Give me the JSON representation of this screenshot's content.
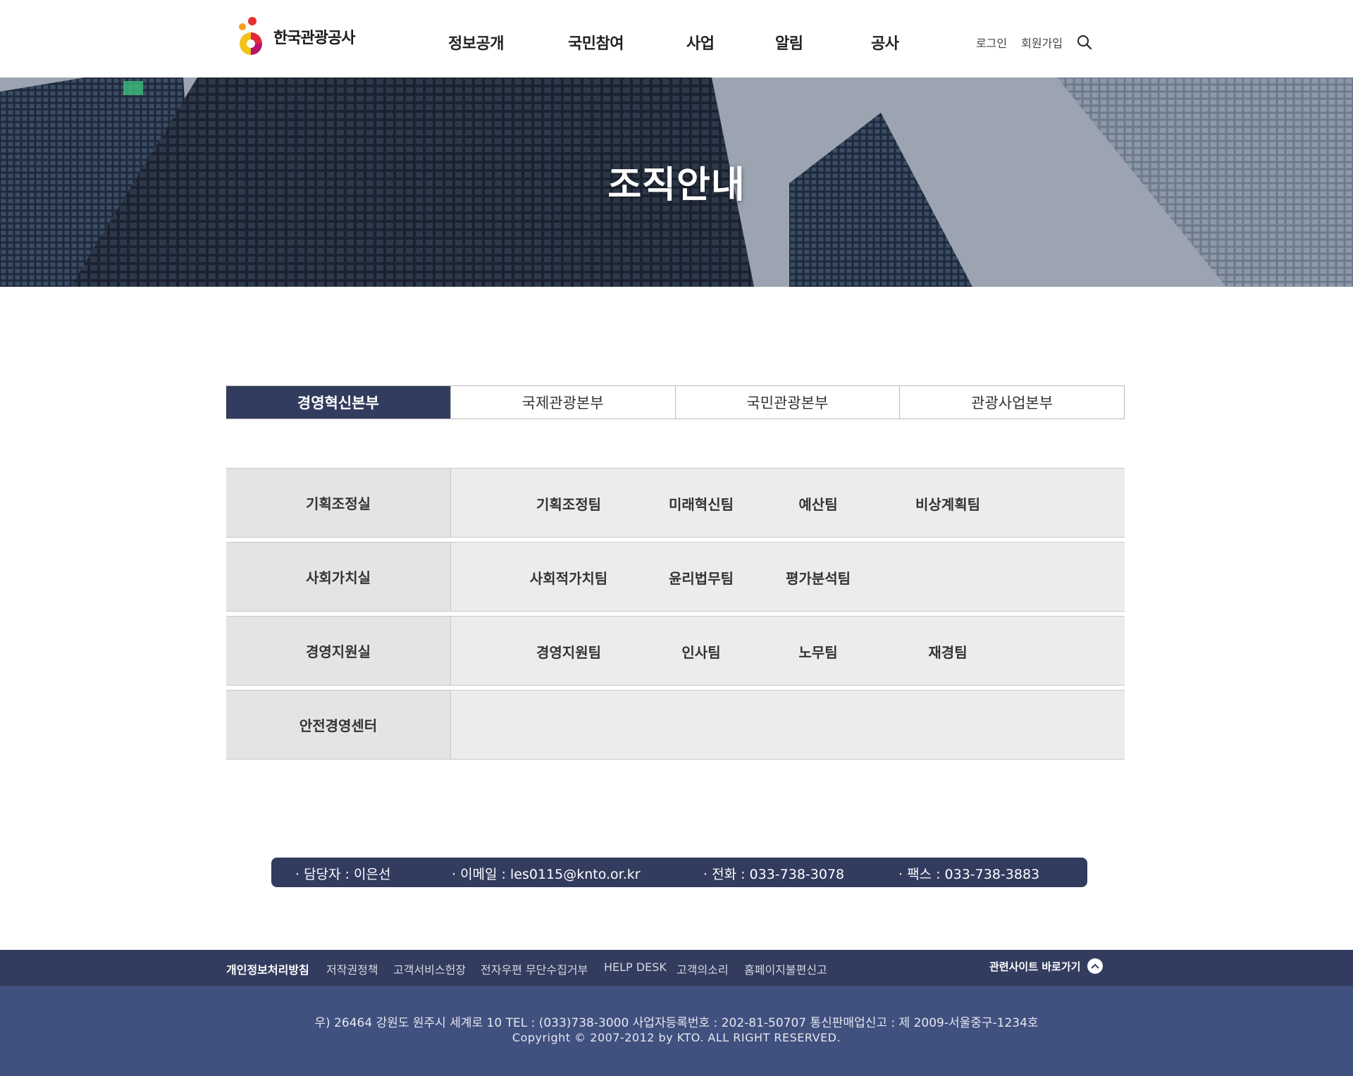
{
  "header": {
    "logo_text": "한국관광공사",
    "nav": [
      "정보공개",
      "국민참여",
      "사업",
      "알림",
      "공사"
    ],
    "login": "로그인",
    "signup": "회원가입"
  },
  "hero": {
    "title": "조직안내"
  },
  "tabs": [
    {
      "label": "경영혁신본부",
      "active": true
    },
    {
      "label": "국제관광본부",
      "active": false
    },
    {
      "label": "국민관광본부",
      "active": false
    },
    {
      "label": "관광사업본부",
      "active": false
    }
  ],
  "org": [
    {
      "dept": "기획조정실",
      "teams": [
        "기획조정팀",
        "미래혁신팀",
        "예산팀",
        "비상계획팀"
      ]
    },
    {
      "dept": "사회가치실",
      "teams": [
        "사회적가치팀",
        "윤리법무팀",
        "평가분석팀"
      ]
    },
    {
      "dept": "경영지원실",
      "teams": [
        "경영지원팀",
        "인사팀",
        "노무팀",
        "재경팀"
      ]
    },
    {
      "dept": "안전경영센터",
      "teams": []
    }
  ],
  "contact": {
    "manager": "· 담당자 : 이은선",
    "email": "· 이메일 : les0115@knto.or.kr",
    "phone": "· 전화 : 033-738-3078",
    "fax": "· 팩스 : 033-738-3883"
  },
  "footer": {
    "links": [
      "개인정보처리방침",
      "저작권정책",
      "고객서비스헌장",
      "전자우편 무단수집거부",
      "HELP DESK",
      "고객의소리",
      "홈페이지불편신고"
    ],
    "related": "관련사이트 바로가기",
    "address": "우) 26464 강원도 원주시 세계로 10 TEL : (033)738-3000 사업자등록번호 : 202-81-50707 통신판매업신고 : 제 2009-서울중구-1234호",
    "copyright": "Copyright © 2007-2012 by KTO. ALL RIGHT RESERVED."
  },
  "colors": {
    "primary": "#323c5e",
    "footer_bg": "#40507f",
    "row_head": "#e4e4e4",
    "row_body": "#ececec"
  }
}
